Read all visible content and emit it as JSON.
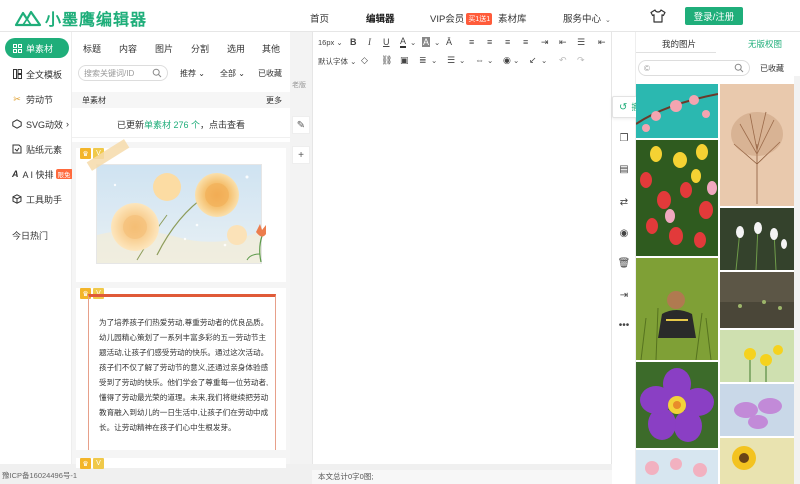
{
  "header": {
    "logo_text": "小墨鹰编辑器",
    "nav": [
      {
        "label": "首页",
        "active": false
      },
      {
        "label": "编辑器",
        "active": true
      },
      {
        "label": "VIP会员",
        "badge": "买1送1",
        "active": false
      },
      {
        "label": "素材库",
        "active": false
      },
      {
        "label": "服务中心",
        "active": false
      }
    ],
    "login_label": "登录/注册",
    "brand_color": "#1fae7a"
  },
  "sidebar": {
    "items": [
      {
        "label": "单素材",
        "icon": "grid-icon",
        "active": true
      },
      {
        "label": "全文模板",
        "icon": "template-icon"
      },
      {
        "label": "劳动节",
        "icon": "tools-icon"
      },
      {
        "label": "SVG动效",
        "icon": "svg-icon",
        "arrow": "›"
      },
      {
        "label": "贴纸元素",
        "icon": "sticker-icon"
      },
      {
        "label": "A I 快排",
        "icon": "ai-icon",
        "hot": "限免"
      },
      {
        "label": "工具助手",
        "icon": "cube-icon"
      },
      {
        "label": "今日热门",
        "icon": ""
      }
    ]
  },
  "panel": {
    "tabs": [
      "标题",
      "内容",
      "图片",
      "分割",
      "选用",
      "其他"
    ],
    "search_placeholder": "搜索关键词/ID",
    "filters": [
      "推荐",
      "全部",
      "已收藏"
    ],
    "sub_header_left": "单素材",
    "sub_header_right": "更多",
    "updated_prefix": "已更新",
    "updated_count": "单素材 276 个",
    "updated_suffix": "，点击查看",
    "card_text": "为了培养孩子们热爱劳动,尊重劳动者的优良品质。幼儿园精心策划了一系列丰富多彩的五一劳动节主题活动,让孩子们感受劳动的快乐。通过这次活动。孩子们不仅了解了劳动节的意义,还通过亲身体验感受到了劳动的快乐。他们学会了尊重每一位劳动者,懂得了劳动最光荣的道理。未来,我们将继续把劳动教育融入到幼儿的一日生活中,让孩子们在劳动中成长。让劳动精神在孩子们心中生根发芽。"
  },
  "editor": {
    "font_size": "16px",
    "font_family": "默认字体",
    "side_label": "老版",
    "status": "本文总计0字0图;",
    "icp": "豫ICP备16024496号-1"
  },
  "actions": {
    "undo_label": "撤销"
  },
  "images": {
    "tab_mine": "我的图片",
    "tab_free": "无版权图",
    "search_placeholder": "©",
    "collected": "已收藏"
  }
}
